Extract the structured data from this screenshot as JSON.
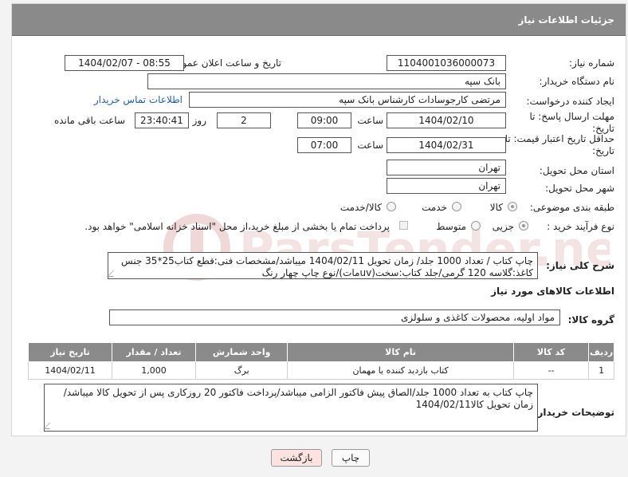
{
  "header": {
    "title": "جزئیات اطلاعات نیاز"
  },
  "fields": {
    "need_number_label": "شماره نیاز:",
    "need_number": "1104001036000073",
    "announce_label": "تاریخ و ساعت اعلان عمومی:",
    "announce_value": "1404/02/07 - 08:55",
    "buyer_label": "نام دستگاه خریدار:",
    "buyer_value": "بانک سپه",
    "creator_label": "ایجاد کننده درخواست:",
    "creator_value": "مرتضی کارجوسادات کارشناس بانک سپه",
    "contact_link": "اطلاعات تماس خریدار",
    "deadline_label": "مهلت ارسال پاسخ: تا تاریخ:",
    "deadline_date": "1404/02/10",
    "time_label": "ساعت",
    "deadline_time": "09:00",
    "days_value": "2",
    "days_label": "روز و",
    "remaining_time": "23:40:41",
    "remaining_label": "ساعت باقی مانده",
    "validity_label": "حداقل تاریخ اعتبار قیمت: تا تاریخ:",
    "validity_date": "1404/02/31",
    "validity_time": "07:00",
    "province_label": "استان محل تحویل:",
    "province_value": "تهران",
    "city_label": "شهر محل تحویل:",
    "city_value": "تهران",
    "category_label": "طبقه بندی موضوعی:",
    "category_options": [
      "کالا",
      "خدمت",
      "کالا/خدمت"
    ],
    "category_selected": "کالا",
    "process_label": "نوع فرآیند خرید :",
    "process_options": [
      "جزیی",
      "متوسط"
    ],
    "process_selected": "جزیی",
    "payment_note": "پرداخت تمام یا بخشی از مبلغ خرید،از محل \"اسناد خزانه اسلامی\" خواهد بود."
  },
  "description": {
    "label": "شرح کلی نیاز:",
    "text": "چاپ کتاب / تعداد 1000 جلد/ زمان تحویل 1404/02/11 میباشد/مشخصات فنی:قطع کتاب25*35 جنس کاغذ:گلاسه 120 گرمی/جلد کتاب:سخت(uvمات)/نوع چاپ چهار رنگ"
  },
  "goods": {
    "section_title": "اطلاعات کالاهای مورد نیاز",
    "group_label": "گروه کالا:",
    "group_value": "مواد اولیه، محصولات کاغذی و سلولزی",
    "columns": [
      "ردیف",
      "کد کالا",
      "نام کالا",
      "واحد شمارش",
      "تعداد / مقدار",
      "تاریخ نیاز"
    ],
    "rows": [
      {
        "row": "1",
        "code": "--",
        "name": "کتاب بازدید کننده یا مهمان",
        "unit": "برگ",
        "qty": "1,000",
        "date": "1404/02/11"
      }
    ]
  },
  "buyer_notes": {
    "label": "توضیحات خریدار:",
    "text": "چاپ کتاب به تعداد 1000 جلد/الصاق پیش فاکتور الزامی میباشد/پرداخت فاکتور 20 روزکاری پس از تحویل کالا میباشد/ زمان تحویل کالا1404/02/11"
  },
  "buttons": {
    "print": "چاپ",
    "back": "بازگشت"
  },
  "watermark_text": "ParsTender.net",
  "colors": {
    "header_bg": "#8a8a8a",
    "link": "#1a5fb4",
    "back_btn": "#fde2e2"
  }
}
